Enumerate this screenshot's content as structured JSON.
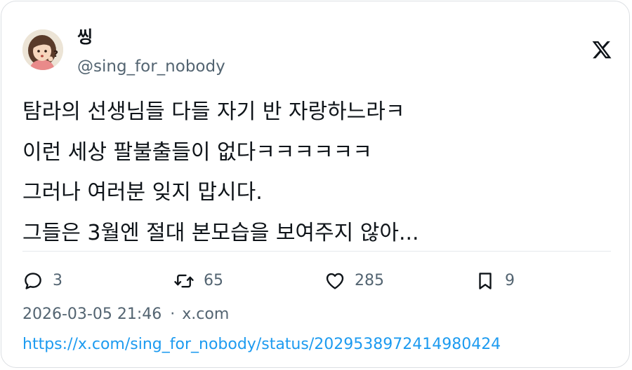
{
  "author": {
    "display_name": "씽",
    "handle": "@sing_for_nobody",
    "avatar": "cartoon-girl-thinking-icon"
  },
  "brand": {
    "logo": "x-logo-icon"
  },
  "tweet": {
    "lines": [
      "탐라의 선생님들 다들 자기 반 자랑하느라ㅋ",
      "이런 세상 팔불출들이 없다ㅋㅋㅋㅋㅋㅋ",
      "그러나 여러분 잊지 맙시다.",
      "그들은 3월엔 절대 본모습을 보여주지 않아..."
    ]
  },
  "actions": {
    "replies": "3",
    "reposts": "65",
    "likes": "285",
    "bookmarks": "9"
  },
  "meta": {
    "datetime": "2026-03-05 21:46",
    "separator": "·",
    "source": "x.com"
  },
  "link": {
    "url": "https://x.com/sing_for_nobody/status/2029538972414980424"
  },
  "colors": {
    "text": "#0f1419",
    "secondary": "#536471",
    "link": "#1d9bf0",
    "border": "#dcdfe3"
  }
}
